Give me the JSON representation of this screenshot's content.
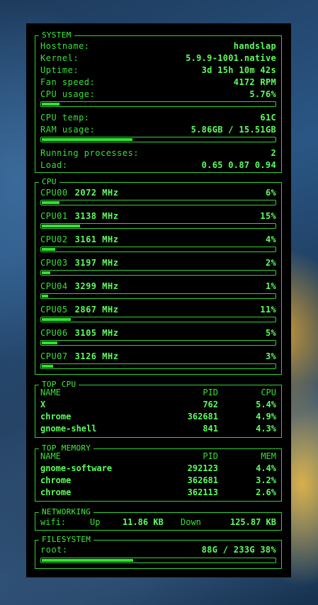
{
  "system": {
    "title": "SYSTEM",
    "hostname_label": "Hostname:",
    "hostname": "handslap",
    "kernel_label": "Kernel:",
    "kernel": "5.9.9-1001.native",
    "uptime_label": "Uptime:",
    "uptime": "3d 15h 10m 42s",
    "fan_label": "Fan speed:",
    "fan": "4172 RPM",
    "cpu_usage_label": "CPU usage:",
    "cpu_usage": "5.76%",
    "cpu_usage_pct": 5.76,
    "cpu_temp_label": "CPU temp:",
    "cpu_temp": "61C",
    "ram_label": "RAM usage:",
    "ram": "5.86GB / 15.51GB",
    "ram_pct": 37.8,
    "procs_label": "Running processes:",
    "procs": "2",
    "load_label": "Load:",
    "load": "0.65 0.87 0.94"
  },
  "cpu": {
    "title": "CPU",
    "cores": [
      {
        "name": "CPU00",
        "mhz": "2072 MHz",
        "usage": "6%",
        "pct": 6
      },
      {
        "name": "CPU01",
        "mhz": "3138 MHz",
        "usage": "15%",
        "pct": 15
      },
      {
        "name": "CPU02",
        "mhz": "3161 MHz",
        "usage": "4%",
        "pct": 4
      },
      {
        "name": "CPU03",
        "mhz": "3197 MHz",
        "usage": "2%",
        "pct": 2
      },
      {
        "name": "CPU04",
        "mhz": "3299 MHz",
        "usage": "1%",
        "pct": 1
      },
      {
        "name": "CPU05",
        "mhz": "2867 MHz",
        "usage": "11%",
        "pct": 11
      },
      {
        "name": "CPU06",
        "mhz": "3105 MHz",
        "usage": "5%",
        "pct": 5
      },
      {
        "name": "CPU07",
        "mhz": "3126 MHz",
        "usage": "3%",
        "pct": 3
      }
    ]
  },
  "top_cpu": {
    "title": "TOP CPU",
    "headers": [
      "NAME",
      "PID",
      "CPU"
    ],
    "rows": [
      [
        "X",
        "762",
        "5.4%"
      ],
      [
        "chrome",
        "362681",
        "4.9%"
      ],
      [
        "gnome-shell",
        "841",
        "4.3%"
      ]
    ]
  },
  "top_mem": {
    "title": "TOP MEMORY",
    "headers": [
      "NAME",
      "PID",
      "MEM"
    ],
    "rows": [
      [
        "gnome-software",
        "292123",
        "4.4%"
      ],
      [
        "chrome",
        "362681",
        "3.2%"
      ],
      [
        "chrome",
        "362113",
        "2.6%"
      ]
    ]
  },
  "net": {
    "title": "NETWORKING",
    "iface": "wifi:",
    "up_label": "Up",
    "up": "11.86 KB",
    "down_label": "Down",
    "down": "125.87 KB"
  },
  "fs": {
    "title": "FILESYSTEM",
    "mount": "root:",
    "usage": "88G / 233G 38%",
    "pct": 38
  }
}
